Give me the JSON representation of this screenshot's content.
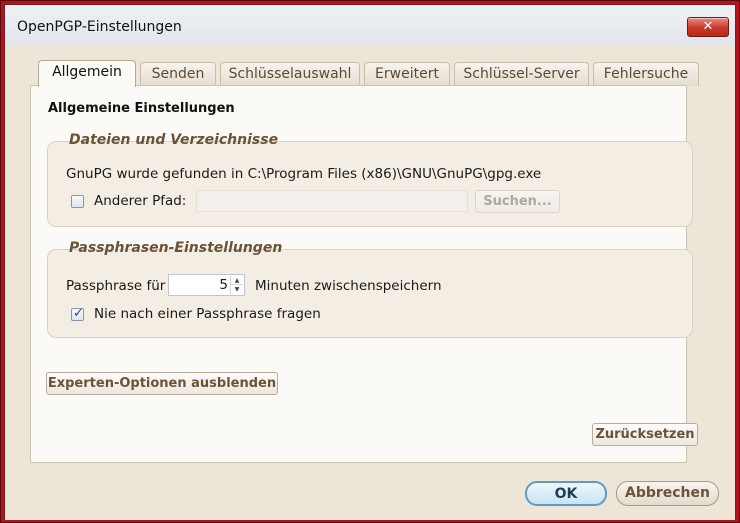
{
  "window": {
    "title": "OpenPGP-Einstellungen",
    "close_glyph": "✕"
  },
  "tabs": [
    {
      "label": "Allgemein",
      "active": true
    },
    {
      "label": "Senden",
      "active": false
    },
    {
      "label": "Schlüsselauswahl",
      "active": false
    },
    {
      "label": "Erweitert",
      "active": false
    },
    {
      "label": "Schlüssel-Server",
      "active": false
    },
    {
      "label": "Fehlersuche",
      "active": false
    }
  ],
  "general": {
    "heading": "Allgemeine Einstellungen",
    "files_group": {
      "title": "Dateien und Verzeichnisse",
      "gpg_found_text": "GnuPG wurde gefunden in C:\\Program Files (x86)\\GNU\\GnuPG\\gpg.exe",
      "other_path_label": "Anderer Pfad:",
      "other_path_checked": false,
      "other_path_value": "",
      "browse_button": "Suchen..."
    },
    "passphrase_group": {
      "title": "Passphrasen-Einstellungen",
      "cache_prefix": "Passphrase für",
      "cache_minutes": "5",
      "cache_suffix": "Minuten zwischenspeichern",
      "never_ask_label": "Nie nach einer Passphrase fragen",
      "never_ask_checked": true
    },
    "expert_button": "Experten-Optionen ausblenden",
    "reset_button": "Zurücksetzen"
  },
  "dialog": {
    "ok_button": "OK",
    "cancel_button": "Abbrechen"
  },
  "colors": {
    "frame": "#b5131c",
    "accent_text": "#6b5338",
    "ok_border": "#5e9bc4"
  }
}
